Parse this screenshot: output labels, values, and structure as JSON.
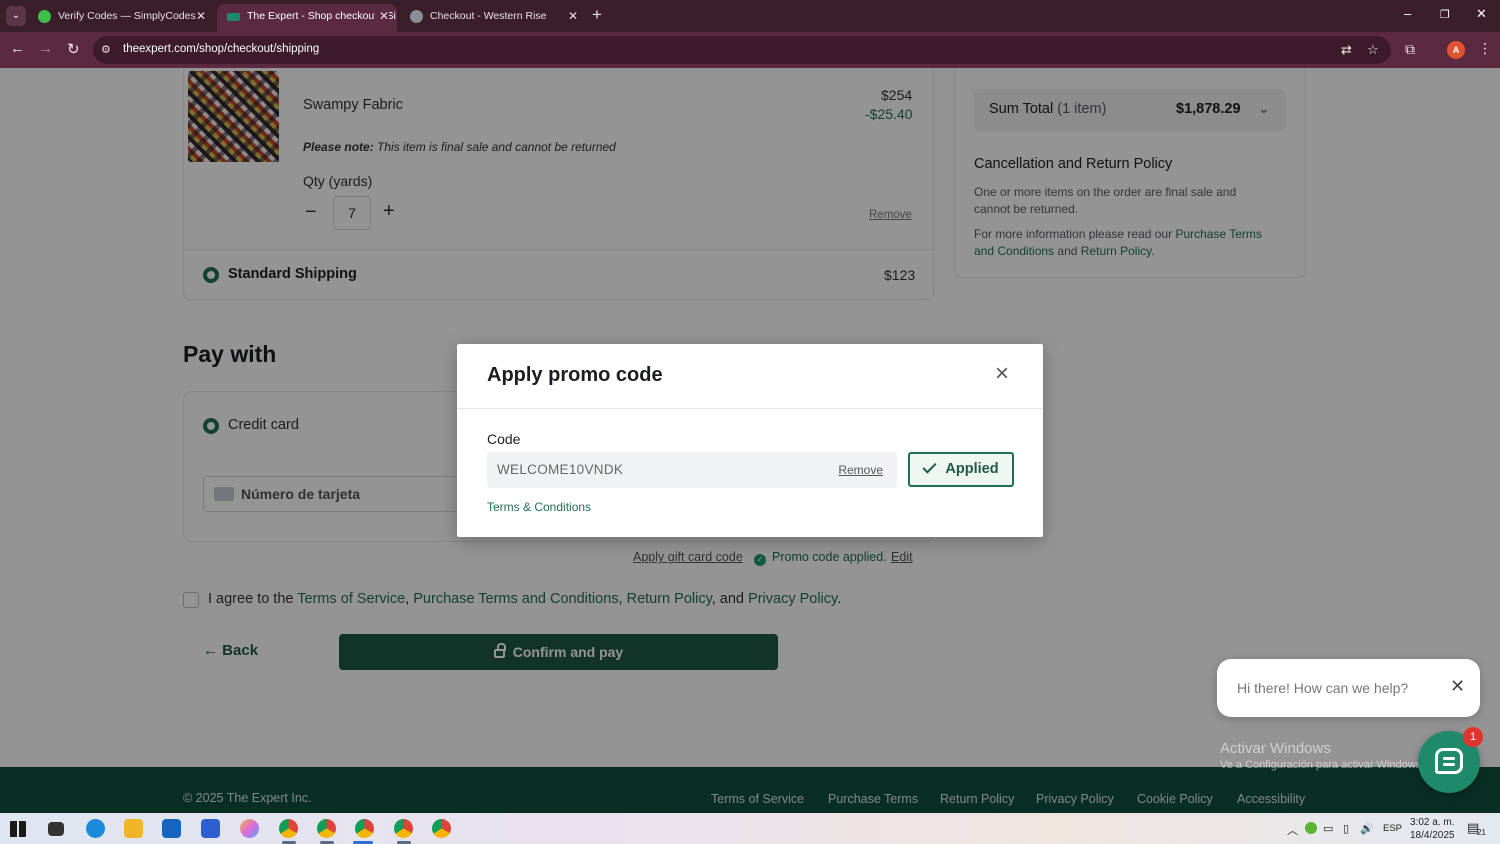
{
  "browser": {
    "tabs": [
      {
        "title": "Verify Codes — SimplyCodes",
        "active": false
      },
      {
        "title": "The Expert - Shop checkout - Si",
        "active": true
      },
      {
        "title": "Checkout - Western Rise",
        "active": false
      }
    ],
    "url": "theexpert.com/shop/checkout/shipping",
    "profile_initial": "A"
  },
  "order": {
    "item_name": "Swampy Fabric",
    "item_price": "$254",
    "item_discount": "-$25.40",
    "note_label": "Please note:",
    "note_text": " This item is final sale and cannot be returned",
    "qty_label": "Qty (yards)",
    "qty_value": "7",
    "qty_minus": "−",
    "qty_plus": "+",
    "remove_label": "Remove",
    "shipping_label": "Standard Shipping",
    "shipping_price": "$123"
  },
  "summary": {
    "total_label": "Sum Total",
    "total_items": "(1 item)",
    "total_value": "$1,878.29",
    "policy_title": "Cancellation and Return Policy",
    "policy_text": "One or more items on the order are final sale and cannot be returned.",
    "info_prefix": "For more information please read our ",
    "info_link1a": "Purchase Terms",
    "info_link1b": "and Conditions",
    "info_mid": " and ",
    "info_link2": "Return Policy",
    "info_end": "."
  },
  "payment": {
    "heading": "Pay with",
    "method": "Credit card",
    "card_placeholder": "Número de tarjeta",
    "gift_card_link": "Apply gift card code",
    "promo_status": "Promo code applied.",
    "promo_edit": "Edit",
    "agree_prefix": "I agree to the ",
    "tos": "Terms of Service",
    "sep1": ", ",
    "pt": "Purchase Terms and Conditions",
    "sep2": ", ",
    "rp": "Return Policy",
    "sep3": ", and ",
    "pp": "Privacy Policy",
    "agree_end": ".",
    "back": "Back",
    "confirm": "Confirm and pay"
  },
  "footer": {
    "copyright": "© 2025 The Expert Inc.",
    "links": [
      "Terms of Service",
      "Purchase Terms",
      "Return Policy",
      "Privacy Policy",
      "Cookie Policy",
      "Accessibility"
    ]
  },
  "modal": {
    "title": "Apply promo code",
    "code_label": "Code",
    "code_value": "WELCOME10VNDK",
    "remove": "Remove",
    "applied": "Applied",
    "terms": "Terms & Conditions"
  },
  "chat": {
    "greeting": "Hi there! How can we help?",
    "badge": "1"
  },
  "watermark": {
    "line1": "Activar Windows",
    "line2": "Ve a Configuración para activar Windows."
  },
  "taskbar": {
    "lang": "ESP",
    "time": "3:02 a. m.",
    "date": "18/4/2025",
    "notif": "21"
  },
  "colors": {
    "brand_green": "#1f6f56",
    "footer_green": "#11503f",
    "browser_chrome": "#5c2a40"
  }
}
